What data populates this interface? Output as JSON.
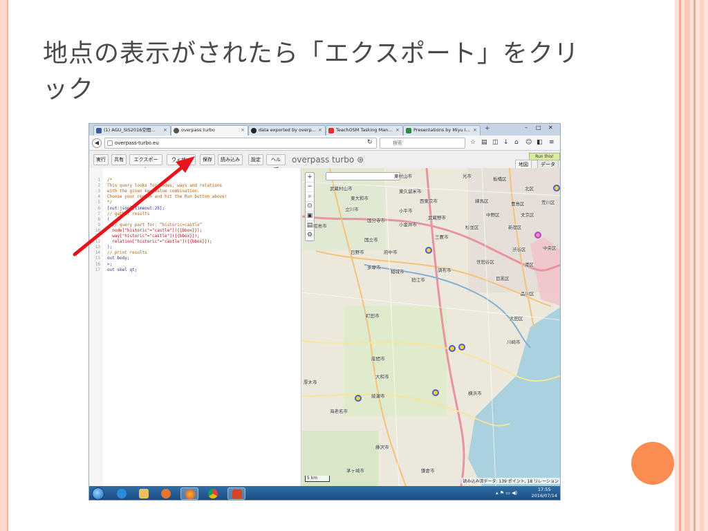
{
  "slide": {
    "title": "地点の表示がされたら「エクスポート」をクリック"
  },
  "colors": {
    "accent_orange": "#fb8d52",
    "annotation_arrow": "#e8141b",
    "map_marker_fill": "#ffcc00",
    "map_marker_stroke": "#4d5fd0"
  },
  "browser": {
    "tabs": [
      {
        "label": "(1) AGU_SIS2016空間...",
        "icon": "facebook-icon"
      },
      {
        "label": "overpass turbo",
        "icon": "overpass-icon"
      },
      {
        "label": "data exported by overp...",
        "icon": "github-icon"
      },
      {
        "label": "TeachOSM Tasking Man...",
        "icon": "teachosm-icon"
      },
      {
        "label": "Presentations by Miyu I...",
        "icon": "slides-icon"
      }
    ],
    "new_tab": "+",
    "url": "overpass-turbo.eu",
    "search_placeholder": "検索",
    "window_controls": [
      "–",
      "□",
      "✕"
    ]
  },
  "overpass": {
    "toolbar": [
      "実行",
      "共有",
      "エクスポート",
      "ウィザード",
      "保存",
      "読み込み",
      "設定",
      "ヘルプ"
    ],
    "brand": "overpass turbo ⊛",
    "run_this": "Run this!",
    "map_tabs": [
      "地図",
      "データ"
    ],
    "code_lines": [
      "/*",
      "This query looks for nodes, ways and relations",
      "with the given key/value combination.",
      "Choose your region and hit the Run button above!",
      "*/",
      "[out:json][timeout:25];",
      "// gather results",
      "(",
      "  // query part for: “historic=castle”",
      "  node[\"historic\"=\"castle\"]({{bbox}});",
      "  way[\"historic\"=\"castle\"]({{bbox}});",
      "  relation[\"historic\"=\"castle\"]({{bbox}});",
      ");",
      "// print results",
      "out body;",
      ">;",
      "out skel qt;"
    ]
  },
  "map": {
    "zoom_controls": [
      "+",
      "−",
      "⌕",
      "⊙",
      "▣",
      "▤",
      "⚙"
    ],
    "search_icon_label": "⌕",
    "places": [
      "東村山市",
      "光市",
      "板橋区",
      "武蔵村山市",
      "東久留米市",
      "北区",
      "東大和市",
      "西東京市",
      "練馬区",
      "豊島区",
      "荒川区",
      "立川市",
      "小平市",
      "中野区",
      "文京区",
      "昭島市",
      "国分寺市",
      "小金井市",
      "武蔵野市",
      "杉並区",
      "新宿区",
      "国立市",
      "三鷹市",
      "日野市",
      "府中市",
      "渋谷区",
      "中央区",
      "多摩市",
      "調布市",
      "世田谷区",
      "港区",
      "稲城市",
      "狛江市",
      "目黒区",
      "品川区",
      "町田市",
      "大田区",
      "川崎市",
      "座間市",
      "大和市",
      "綾瀬市",
      "横浜市",
      "海老名市",
      "藤沢市",
      "茅ヶ崎市",
      "鎌倉市",
      "厚木市"
    ],
    "scale": "5 km",
    "status": "読み込み済データ: 139 ポイント, 18 リレーション"
  },
  "taskbar": {
    "time": "17:55",
    "date": "2016/07/14"
  }
}
